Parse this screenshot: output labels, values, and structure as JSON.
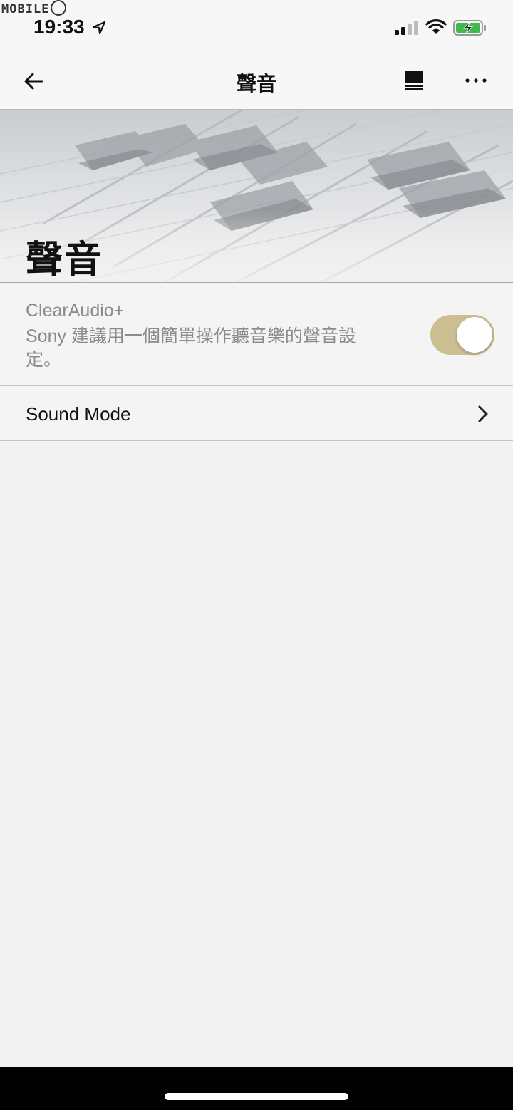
{
  "watermark": {
    "text": "MOBILE"
  },
  "status_bar": {
    "time": "19:33"
  },
  "nav": {
    "title": "聲音"
  },
  "banner": {
    "title": "聲音"
  },
  "clearaudio": {
    "title": "ClearAudio+",
    "description": "Sony 建議用一個簡單操作聽音樂的聲音設定。",
    "toggle_on": true
  },
  "sound_mode": {
    "label": "Sound Mode"
  },
  "colors": {
    "toggle_on": "#cbbf92",
    "background": "#f3f3f3",
    "text_primary": "#111111",
    "text_secondary": "#8b8b8b"
  },
  "icons": [
    "back-arrow-icon",
    "queue-icon",
    "more-icon",
    "chevron-right-icon",
    "location-icon",
    "signal-icon",
    "wifi-icon",
    "battery-charging-icon"
  ]
}
